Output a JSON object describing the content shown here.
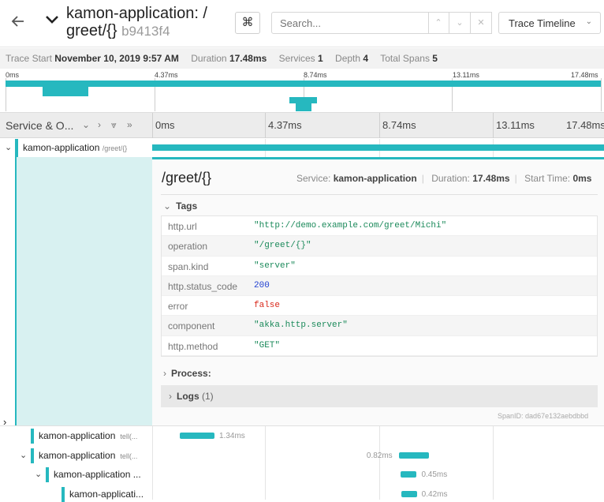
{
  "colors": {
    "accent": "#26b8bf",
    "string": "#1c8a5b",
    "number": "#1f3fd1",
    "bool": "#d9281a"
  },
  "header": {
    "back_icon": "arrow-left-icon",
    "collapse_icon": "chevron-down-icon",
    "title_line1": "kamon-application: /",
    "title_line2": "greet/{}",
    "trace_id": "b9413f4",
    "shortcut_label": "⌘",
    "search_placeholder": "Search...",
    "view_label": "Trace Timeline"
  },
  "summary": {
    "trace_start_label": "Trace Start",
    "trace_start": "November 10, 2019 9:57 AM",
    "duration_label": "Duration",
    "duration": "17.48ms",
    "services_label": "Services",
    "services": "1",
    "depth_label": "Depth",
    "depth": "4",
    "total_spans_label": "Total Spans",
    "total_spans": "5"
  },
  "minimap": {
    "ticks": [
      "0ms",
      "4.37ms",
      "8.74ms",
      "13.11ms",
      "17.48ms"
    ]
  },
  "columns": {
    "service_label": "Service & O...",
    "ticks": [
      "0ms",
      "4.37ms",
      "8.74ms",
      "13.11ms",
      "17.48ms"
    ]
  },
  "root_span": {
    "service": "kamon-application",
    "operation": "/greet/{}"
  },
  "detail": {
    "title": "/greet/{}",
    "service_label": "Service:",
    "service": "kamon-application",
    "duration_label": "Duration:",
    "duration": "17.48ms",
    "start_label": "Start Time:",
    "start": "0ms",
    "tags_label": "Tags",
    "tags": [
      {
        "key": "http.url",
        "value": "\"http://demo.example.com/greet/Michi\"",
        "kind": "string"
      },
      {
        "key": "operation",
        "value": "\"/greet/{}\"",
        "kind": "string"
      },
      {
        "key": "span.kind",
        "value": "\"server\"",
        "kind": "string"
      },
      {
        "key": "http.status_code",
        "value": "200",
        "kind": "number"
      },
      {
        "key": "error",
        "value": "false",
        "kind": "bool"
      },
      {
        "key": "component",
        "value": "\"akka.http.server\"",
        "kind": "string"
      },
      {
        "key": "http.method",
        "value": "\"GET\"",
        "kind": "string"
      }
    ],
    "process_label": "Process:",
    "logs_label": "Logs",
    "logs_count": "(1)",
    "span_id_label": "SpanID:",
    "span_id": "dad67e132aebdbbd"
  },
  "child_spans": [
    {
      "service": "kamon-application",
      "op": "tell(...",
      "duration": "1.34ms",
      "start_ms": 0.0,
      "dur_ms": 1.34
    },
    {
      "service": "kamon-application",
      "op": "tell(...",
      "duration": "0.82ms",
      "start_ms": 8.74,
      "dur_ms": 0.82
    },
    {
      "service": "kamon-application ...",
      "op": "",
      "duration": "0.45ms",
      "start_ms": 8.8,
      "dur_ms": 0.45
    },
    {
      "service": "kamon-applicati...",
      "op": "",
      "duration": "0.42ms",
      "start_ms": 8.85,
      "dur_ms": 0.42
    }
  ]
}
